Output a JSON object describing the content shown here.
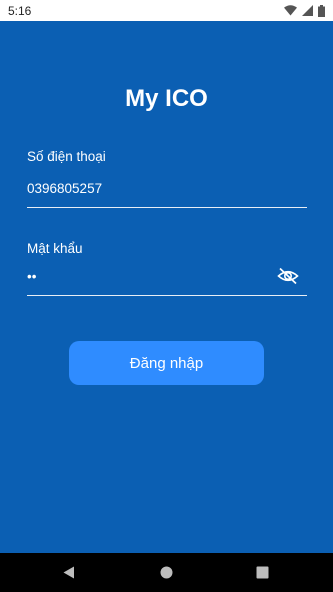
{
  "status_bar": {
    "time": "5:16",
    "icons": [
      "wifi-icon",
      "cellular-signal-icon",
      "battery-icon"
    ]
  },
  "app": {
    "title": "My ICO",
    "phone_field": {
      "label": "Số điện thoại",
      "value": "0396805257"
    },
    "password_field": {
      "label": "Mật khẩu",
      "value": "••",
      "toggle_icon": "eye-off-icon"
    },
    "login_button": {
      "label": "Đăng nhập"
    }
  },
  "nav_bar": {
    "buttons": [
      "back-icon",
      "home-icon",
      "recents-icon"
    ]
  },
  "colors": {
    "background": "#0b5fb3",
    "button": "#2f8cff",
    "text": "#ffffff"
  }
}
